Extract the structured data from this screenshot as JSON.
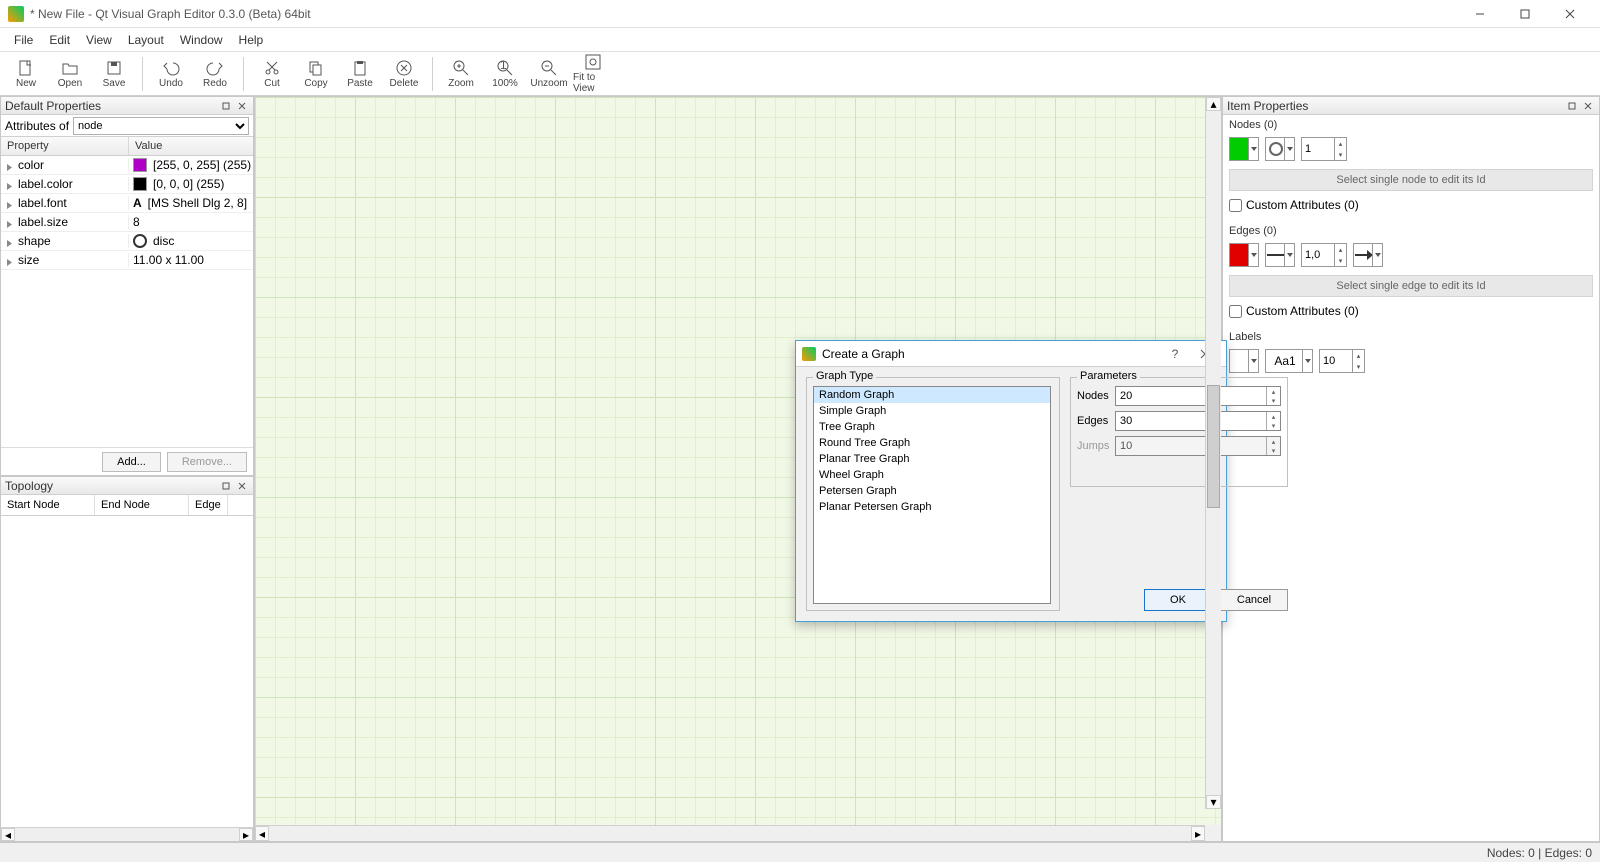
{
  "title": "* New File - Qt Visual Graph Editor 0.3.0 (Beta) 64bit",
  "menu": [
    "File",
    "Edit",
    "View",
    "Layout",
    "Window",
    "Help"
  ],
  "toolbar": [
    {
      "label": "New",
      "icon": "new"
    },
    {
      "label": "Open",
      "icon": "open"
    },
    {
      "label": "Save",
      "icon": "save"
    },
    {
      "sep": true
    },
    {
      "label": "Undo",
      "icon": "undo"
    },
    {
      "label": "Redo",
      "icon": "redo"
    },
    {
      "sep": true
    },
    {
      "label": "Cut",
      "icon": "cut"
    },
    {
      "label": "Copy",
      "icon": "copy"
    },
    {
      "label": "Paste",
      "icon": "paste"
    },
    {
      "label": "Delete",
      "icon": "delete"
    },
    {
      "sep": true
    },
    {
      "label": "Zoom",
      "icon": "zoom"
    },
    {
      "label": "100%",
      "icon": "zoom100"
    },
    {
      "label": "Unzoom",
      "icon": "unzoom"
    },
    {
      "label": "Fit to View",
      "icon": "fit"
    }
  ],
  "leftPanel": {
    "title": "Default Properties",
    "attributesOf": "Attributes of",
    "attrSelected": "node",
    "colProperty": "Property",
    "colValue": "Value",
    "rows": [
      {
        "name": "color",
        "swatch": "#b000c8",
        "value": "[255, 0, 255] (255)"
      },
      {
        "name": "label.color",
        "swatch": "#000000",
        "value": "[0, 0, 0] (255)"
      },
      {
        "name": "label.font",
        "icon": "A",
        "value": "[MS Shell Dlg 2, 8]"
      },
      {
        "name": "label.size",
        "value": "8"
      },
      {
        "name": "shape",
        "icon": "circle",
        "value": "disc"
      },
      {
        "name": "size",
        "value": "11.00 x 11.00"
      }
    ],
    "addBtn": "Add...",
    "removeBtn": "Remove..."
  },
  "topology": {
    "title": "Topology",
    "cols": [
      "Start Node",
      "End Node",
      "Edge"
    ]
  },
  "rightPanel": {
    "title": "Item Properties",
    "nodesLabel": "Nodes (0)",
    "nodeColor": "#00cc00",
    "nodeStroke": "1",
    "nodeHint": "Select single node to edit its Id",
    "nodeCustom": "Custom Attributes (0)",
    "edgesLabel": "Edges (0)",
    "edgeColor": "#e00000",
    "edgeWeight": "1,0",
    "edgeHint": "Select single edge to edit its Id",
    "edgeCustom": "Custom Attributes (0)",
    "labelsLabel": "Labels",
    "labelColor": "#ffffff",
    "labelFont": "Aa1",
    "labelSize": "10"
  },
  "dialog": {
    "title": "Create a Graph",
    "groupType": "Graph Type",
    "groupParams": "Parameters",
    "types": [
      "Random Graph",
      "Simple Graph",
      "Tree Graph",
      "Round Tree Graph",
      "Planar Tree Graph",
      "Wheel Graph",
      "Petersen Graph",
      "Planar Petersen Graph"
    ],
    "selectedType": 0,
    "pNodesLabel": "Nodes",
    "pNodes": "20",
    "pEdgesLabel": "Edges",
    "pEdges": "30",
    "pJumpsLabel": "Jumps",
    "pJumps": "10",
    "ok": "OK",
    "cancel": "Cancel"
  },
  "status": "Nodes: 0 | Edges: 0"
}
